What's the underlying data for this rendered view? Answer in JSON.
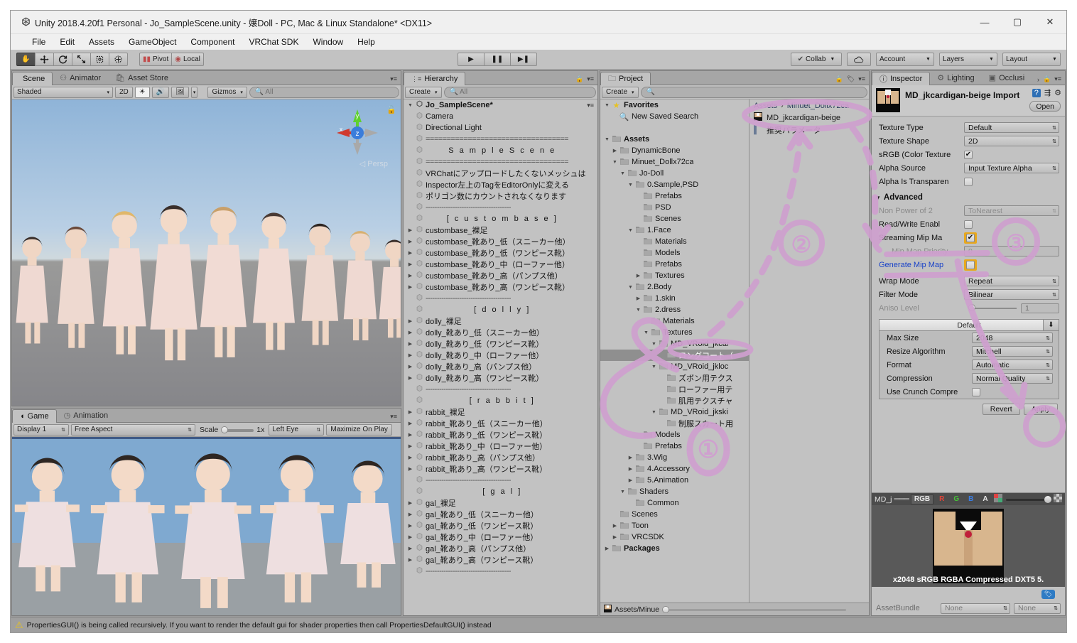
{
  "window": {
    "title": "Unity 2018.4.20f1 Personal - Jo_SampleScene.unity - 嬢Doll - PC, Mac & Linux Standalone* <DX11>",
    "minimize": "—",
    "maximize": "▢",
    "close": "✕",
    "unity_icon": "unity-logo-icon"
  },
  "menu": [
    "File",
    "Edit",
    "Assets",
    "GameObject",
    "Component",
    "VRChat SDK",
    "Window",
    "Help"
  ],
  "toolbar": {
    "transform_tools": [
      "hand-tool",
      "move-tool",
      "rotate-tool",
      "scale-tool",
      "rect-tool",
      "transform-tool"
    ],
    "pivot_label": "Pivot",
    "local_label": "Local",
    "play": "▶",
    "pause": "❚❚",
    "step": "▶❚",
    "collab_label": "Collab",
    "cloud_label": "",
    "account_label": "Account",
    "layers_label": "Layers",
    "layout_label": "Layout"
  },
  "scene_panel": {
    "tabs": [
      {
        "label": "Scene",
        "icon": "scene-icon",
        "active": true
      },
      {
        "label": "Animator",
        "icon": "animator-icon",
        "active": false
      },
      {
        "label": "Asset Store",
        "icon": "store-icon",
        "active": false
      }
    ],
    "shading_mode": "Shaded",
    "mode_2d": "2D",
    "lighting_icon": "sun-icon",
    "audio_icon": "speaker-icon",
    "fx_icon": "image-icon",
    "gizmos_label": "Gizmos",
    "search_placeholder": "All",
    "axis_x": "x",
    "axis_y": "y",
    "axis_z": "z",
    "persp_label": "Persp"
  },
  "game_panel": {
    "tabs": [
      {
        "label": "Game",
        "icon": "game-icon",
        "active": true
      },
      {
        "label": "Animation",
        "icon": "clock-icon",
        "active": false
      }
    ],
    "display": "Display 1",
    "aspect": "Free Aspect",
    "scale_label": "Scale",
    "scale_value": "1x",
    "eye": "Left Eye",
    "maximize": "Maximize On Play"
  },
  "hierarchy": {
    "tab_label": "Hierarchy",
    "tab_icon": "hierarchy-icon",
    "create_label": "Create",
    "search_placeholder": "All",
    "scene_name": "Jo_SampleScene*",
    "items": [
      {
        "label": "Camera",
        "depth": 1,
        "arrow": false
      },
      {
        "label": "Directional Light",
        "depth": 1,
        "arrow": false
      },
      {
        "label": "==================================",
        "depth": 1,
        "arrow": false,
        "kind": "rule"
      },
      {
        "label": "S a m p l e   S c e n e",
        "depth": 1,
        "arrow": false,
        "kind": "header"
      },
      {
        "label": "==================================",
        "depth": 1,
        "arrow": false,
        "kind": "rule"
      },
      {
        "label": "VRChatにアップロードしたくないメッシュは",
        "depth": 1,
        "arrow": false
      },
      {
        "label": "Inspector左上のTagをEditorOnlyに変える",
        "depth": 1,
        "arrow": false
      },
      {
        "label": "ポリゴン数にカウントされなくなります",
        "depth": 1,
        "arrow": false
      },
      {
        "label": "--------------------------------------",
        "depth": 1,
        "arrow": false,
        "kind": "rule"
      },
      {
        "label": "[ c u s t o m   b a s e ]",
        "depth": 1,
        "arrow": false,
        "kind": "header"
      },
      {
        "label": "custombase_裸足",
        "depth": 1,
        "arrow": true
      },
      {
        "label": "custombase_靴あり_低（スニーカー他）",
        "depth": 1,
        "arrow": true
      },
      {
        "label": "custombase_靴あり_低（ワンピース靴）",
        "depth": 1,
        "arrow": true
      },
      {
        "label": "custombase_靴あり_中（ローファー他）",
        "depth": 1,
        "arrow": true
      },
      {
        "label": "custombase_靴あり_高（パンプス他）",
        "depth": 1,
        "arrow": true
      },
      {
        "label": "custombase_靴あり_高（ワンピース靴）",
        "depth": 1,
        "arrow": true
      },
      {
        "label": "--------------------------------------",
        "depth": 1,
        "arrow": false,
        "kind": "rule"
      },
      {
        "label": "[ d o l l y ]",
        "depth": 1,
        "arrow": false,
        "kind": "header"
      },
      {
        "label": "dolly_裸足",
        "depth": 1,
        "arrow": true
      },
      {
        "label": "dolly_靴あり_低（スニーカー他）",
        "depth": 1,
        "arrow": true
      },
      {
        "label": "dolly_靴あり_低（ワンピース靴）",
        "depth": 1,
        "arrow": true
      },
      {
        "label": "dolly_靴あり_中（ローファー他）",
        "depth": 1,
        "arrow": true
      },
      {
        "label": "dolly_靴あり_高（パンプス他）",
        "depth": 1,
        "arrow": true
      },
      {
        "label": "dolly_靴あり_高（ワンピース靴）",
        "depth": 1,
        "arrow": true
      },
      {
        "label": "--------------------------------------",
        "depth": 1,
        "arrow": false,
        "kind": "rule"
      },
      {
        "label": "[ r a b b i t ]",
        "depth": 1,
        "arrow": false,
        "kind": "header"
      },
      {
        "label": "rabbit_裸足",
        "depth": 1,
        "arrow": true
      },
      {
        "label": "rabbit_靴あり_低（スニーカー他）",
        "depth": 1,
        "arrow": true
      },
      {
        "label": "rabbit_靴あり_低（ワンピース靴）",
        "depth": 1,
        "arrow": true
      },
      {
        "label": "rabbit_靴あり_中（ローファー他）",
        "depth": 1,
        "arrow": true
      },
      {
        "label": "rabbit_靴あり_高（パンプス他）",
        "depth": 1,
        "arrow": true
      },
      {
        "label": "rabbit_靴あり_高（ワンピース靴）",
        "depth": 1,
        "arrow": true
      },
      {
        "label": "--------------------------------------",
        "depth": 1,
        "arrow": false,
        "kind": "rule"
      },
      {
        "label": "[ g a l ]",
        "depth": 1,
        "arrow": false,
        "kind": "header"
      },
      {
        "label": "gal_裸足",
        "depth": 1,
        "arrow": true
      },
      {
        "label": "gal_靴あり_低（スニーカー他）",
        "depth": 1,
        "arrow": true
      },
      {
        "label": "gal_靴あり_低（ワンピース靴）",
        "depth": 1,
        "arrow": true
      },
      {
        "label": "gal_靴あり_中（ローファー他）",
        "depth": 1,
        "arrow": true
      },
      {
        "label": "gal_靴あり_高（パンプス他）",
        "depth": 1,
        "arrow": true
      },
      {
        "label": "gal_靴あり_高（ワンピース靴）",
        "depth": 1,
        "arrow": true
      },
      {
        "label": "--------------------------------------",
        "depth": 1,
        "arrow": false,
        "kind": "rule"
      }
    ]
  },
  "project": {
    "tab_label": "Project",
    "tab_icon": "folder-icon",
    "create_label": "Create",
    "search_placeholder": "",
    "tree": [
      {
        "label": "Favorites",
        "depth": 0,
        "arrow": "down",
        "icon": "star-icon",
        "bold": true
      },
      {
        "label": "New Saved Search",
        "depth": 1,
        "arrow": null,
        "icon": "search-icon"
      },
      {
        "label": "",
        "depth": 0,
        "arrow": null,
        "icon": null
      },
      {
        "label": "Assets",
        "depth": 0,
        "arrow": "down",
        "icon": "folder-icon",
        "bold": true
      },
      {
        "label": "DynamicBone",
        "depth": 1,
        "arrow": "right",
        "icon": "folder-icon"
      },
      {
        "label": "Minuet_Dollx72ca",
        "depth": 1,
        "arrow": "down",
        "icon": "folder-icon"
      },
      {
        "label": "Jo-Doll",
        "depth": 2,
        "arrow": "down",
        "icon": "folder-icon"
      },
      {
        "label": "0.Sample,PSD",
        "depth": 3,
        "arrow": "down",
        "icon": "folder-icon"
      },
      {
        "label": "Prefabs",
        "depth": 4,
        "arrow": null,
        "icon": "folder-icon"
      },
      {
        "label": "PSD",
        "depth": 4,
        "arrow": null,
        "icon": "folder-icon"
      },
      {
        "label": "Scenes",
        "depth": 4,
        "arrow": null,
        "icon": "folder-icon"
      },
      {
        "label": "1.Face",
        "depth": 3,
        "arrow": "down",
        "icon": "folder-icon"
      },
      {
        "label": "Materials",
        "depth": 4,
        "arrow": null,
        "icon": "folder-icon"
      },
      {
        "label": "Models",
        "depth": 4,
        "arrow": null,
        "icon": "folder-icon"
      },
      {
        "label": "Prefabs",
        "depth": 4,
        "arrow": null,
        "icon": "folder-icon"
      },
      {
        "label": "Textures",
        "depth": 4,
        "arrow": "right",
        "icon": "folder-icon"
      },
      {
        "label": "2.Body",
        "depth": 3,
        "arrow": "down",
        "icon": "folder-icon"
      },
      {
        "label": "1.skin",
        "depth": 4,
        "arrow": "right",
        "icon": "folder-icon"
      },
      {
        "label": "2.dress",
        "depth": 4,
        "arrow": "down",
        "icon": "folder-icon"
      },
      {
        "label": "Materials",
        "depth": 5,
        "arrow": null,
        "icon": "folder-icon"
      },
      {
        "label": "Textures",
        "depth": 5,
        "arrow": "down",
        "icon": "folder-icon"
      },
      {
        "label": "MD_VRoid_jkcar",
        "depth": 6,
        "arrow": "down",
        "icon": "folder-icon"
      },
      {
        "label": "ロングコート（",
        "depth": 7,
        "arrow": null,
        "icon": "folder-icon",
        "selected": true
      },
      {
        "label": "MD_VRoid_jkloc",
        "depth": 6,
        "arrow": "down",
        "icon": "folder-icon"
      },
      {
        "label": "ズボン用テクス",
        "depth": 7,
        "arrow": null,
        "icon": "folder-icon"
      },
      {
        "label": "ローファー用テ",
        "depth": 7,
        "arrow": null,
        "icon": "folder-icon"
      },
      {
        "label": "肌用テクスチャ",
        "depth": 7,
        "arrow": null,
        "icon": "folder-icon"
      },
      {
        "label": "MD_VRoid_jkski",
        "depth": 6,
        "arrow": "down",
        "icon": "folder-icon"
      },
      {
        "label": "制服スカート用",
        "depth": 7,
        "arrow": null,
        "icon": "folder-icon"
      },
      {
        "label": "Models",
        "depth": 4,
        "arrow": null,
        "icon": "folder-icon"
      },
      {
        "label": "Prefabs",
        "depth": 4,
        "arrow": null,
        "icon": "folder-icon"
      },
      {
        "label": "3.Wig",
        "depth": 3,
        "arrow": "right",
        "icon": "folder-icon"
      },
      {
        "label": "4.Accessory",
        "depth": 3,
        "arrow": "right",
        "icon": "folder-icon"
      },
      {
        "label": "5.Animation",
        "depth": 3,
        "arrow": "right",
        "icon": "folder-icon"
      },
      {
        "label": "Shaders",
        "depth": 2,
        "arrow": "down",
        "icon": "folder-icon"
      },
      {
        "label": "Common",
        "depth": 3,
        "arrow": null,
        "icon": "folder-icon"
      },
      {
        "label": "Scenes",
        "depth": 1,
        "arrow": null,
        "icon": "folder-icon"
      },
      {
        "label": "Toon",
        "depth": 1,
        "arrow": "right",
        "icon": "folder-icon"
      },
      {
        "label": "VRCSDK",
        "depth": 1,
        "arrow": "right",
        "icon": "folder-icon"
      },
      {
        "label": "Packages",
        "depth": 0,
        "arrow": "right",
        "icon": "folder-icon",
        "bold": true
      }
    ],
    "breadcrumb": [
      "Assets",
      "Minuet_Dollx72ca"
    ],
    "breadcrumb_sep": "›",
    "assets": [
      {
        "label": "MD_jkcardigan-beige",
        "icon": "texture-icon"
      },
      {
        "label": "推奨パラメータ",
        "icon": "text-icon"
      }
    ],
    "footer_path": "Assets/Minue"
  },
  "inspector": {
    "tabs": [
      {
        "label": "Inspector",
        "icon": "info-icon",
        "active": true
      },
      {
        "label": "Lighting",
        "icon": "lighting-icon",
        "active": false
      },
      {
        "label": "Occlusi",
        "icon": "occlusion-icon",
        "active": false
      }
    ],
    "asset_title": "MD_jkcardigan-beige Import",
    "help_icon": "help-icon",
    "preset_icon": "preset-icon",
    "gear_icon": "gear-icon",
    "open_label": "Open",
    "properties": [
      {
        "name": "Texture Type",
        "value": "Default",
        "kind": "dropdown"
      },
      {
        "name": "Texture Shape",
        "value": "2D",
        "kind": "dropdown"
      },
      {
        "name": "sRGB (Color Texture",
        "value": true,
        "kind": "checkbox"
      },
      {
        "name": "Alpha Source",
        "value": "Input Texture Alpha",
        "kind": "dropdown"
      },
      {
        "name": "Alpha Is Transparen",
        "value": false,
        "kind": "checkbox"
      }
    ],
    "advanced_label": "Advanced",
    "advanced": [
      {
        "name": "Non Power of 2",
        "value": "ToNearest",
        "kind": "dropdown",
        "dim": true
      },
      {
        "name": "Read/Write Enabl",
        "value": false,
        "kind": "checkbox"
      },
      {
        "name": "Streaming Mip Ma",
        "value": true,
        "kind": "checkbox",
        "highlight": true
      },
      {
        "name": "Mip Map Priority",
        "value": "0",
        "kind": "text",
        "dim": true,
        "indent": true
      },
      {
        "name": "Generate Mip Map",
        "value": false,
        "kind": "checkbox",
        "highlight": true,
        "link": true
      }
    ],
    "wrap": [
      {
        "name": "Wrap Mode",
        "value": "Repeat",
        "kind": "dropdown"
      },
      {
        "name": "Filter Mode",
        "value": "Bilinear",
        "kind": "dropdown"
      },
      {
        "name": "Aniso Level",
        "value": "1",
        "kind": "slider",
        "dim": true
      }
    ],
    "platform_label": "Default",
    "platform_props": [
      {
        "name": "Max Size",
        "value": "2048"
      },
      {
        "name": "Resize Algorithm",
        "value": "Mitchell"
      },
      {
        "name": "Format",
        "value": "Automatic"
      },
      {
        "name": "Compression",
        "value": "Normal Quality"
      }
    ],
    "crunch_label": "Use Crunch Compre",
    "crunch_value": false,
    "revert_label": "Revert",
    "apply_label": "Apply",
    "preview": {
      "name": "MD_j",
      "channels": [
        "RGB",
        "R",
        "G",
        "B",
        "A"
      ],
      "format_text": "x2048 sRGB  RGBA Compressed DXT5   5.",
      "tag_icon": "tag-icon",
      "assetbundle_label": "AssetBundle",
      "assetbundle_value": "None",
      "assetbundle_variant": "None"
    }
  },
  "statusbar": {
    "warning_icon": "warning-icon",
    "message": "PropertiesGUI() is being called recursively. If you want to render the default gui for shader properties then call PropertiesDefaultGUI() instead"
  },
  "annotations": {
    "color": "#cfa0cf",
    "markers": [
      "①",
      "②",
      "③"
    ],
    "highlight_color": "#e8a81e"
  }
}
